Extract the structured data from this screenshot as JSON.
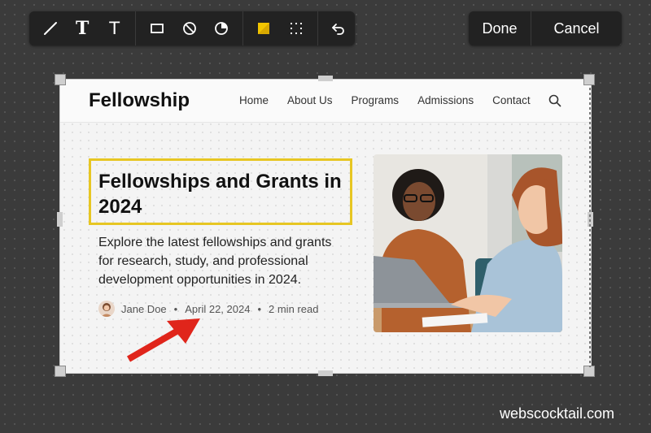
{
  "toolbar": {
    "tools": [
      {
        "icon": "line-icon"
      },
      {
        "icon": "text-bold-icon",
        "label": "T"
      },
      {
        "icon": "text-icon",
        "label": "T"
      },
      {
        "icon": "rectangle-icon"
      },
      {
        "icon": "blur-icon"
      },
      {
        "icon": "pie-icon"
      },
      {
        "icon": "highlighter-icon"
      },
      {
        "icon": "dotted-select-icon"
      },
      {
        "icon": "undo-icon"
      }
    ],
    "highlight_color": "#f2c500"
  },
  "actions": {
    "done_label": "Done",
    "cancel_label": "Cancel"
  },
  "site": {
    "logo": "Fellowship",
    "nav": [
      "Home",
      "About Us",
      "Programs",
      "Admissions",
      "Contact"
    ],
    "headline": "Fellowships and Grants in 2024",
    "description": "Explore the latest fellowships and grants for research, study, and professional development opportunities in 2024.",
    "author": "Jane Doe",
    "date": "April 22, 2024",
    "read_time": "2 min read",
    "bullet": "•",
    "highlight_box_color": "#e7c623"
  },
  "annotation": {
    "arrow_color": "#e0251b"
  },
  "watermark": "webscocktail.com"
}
